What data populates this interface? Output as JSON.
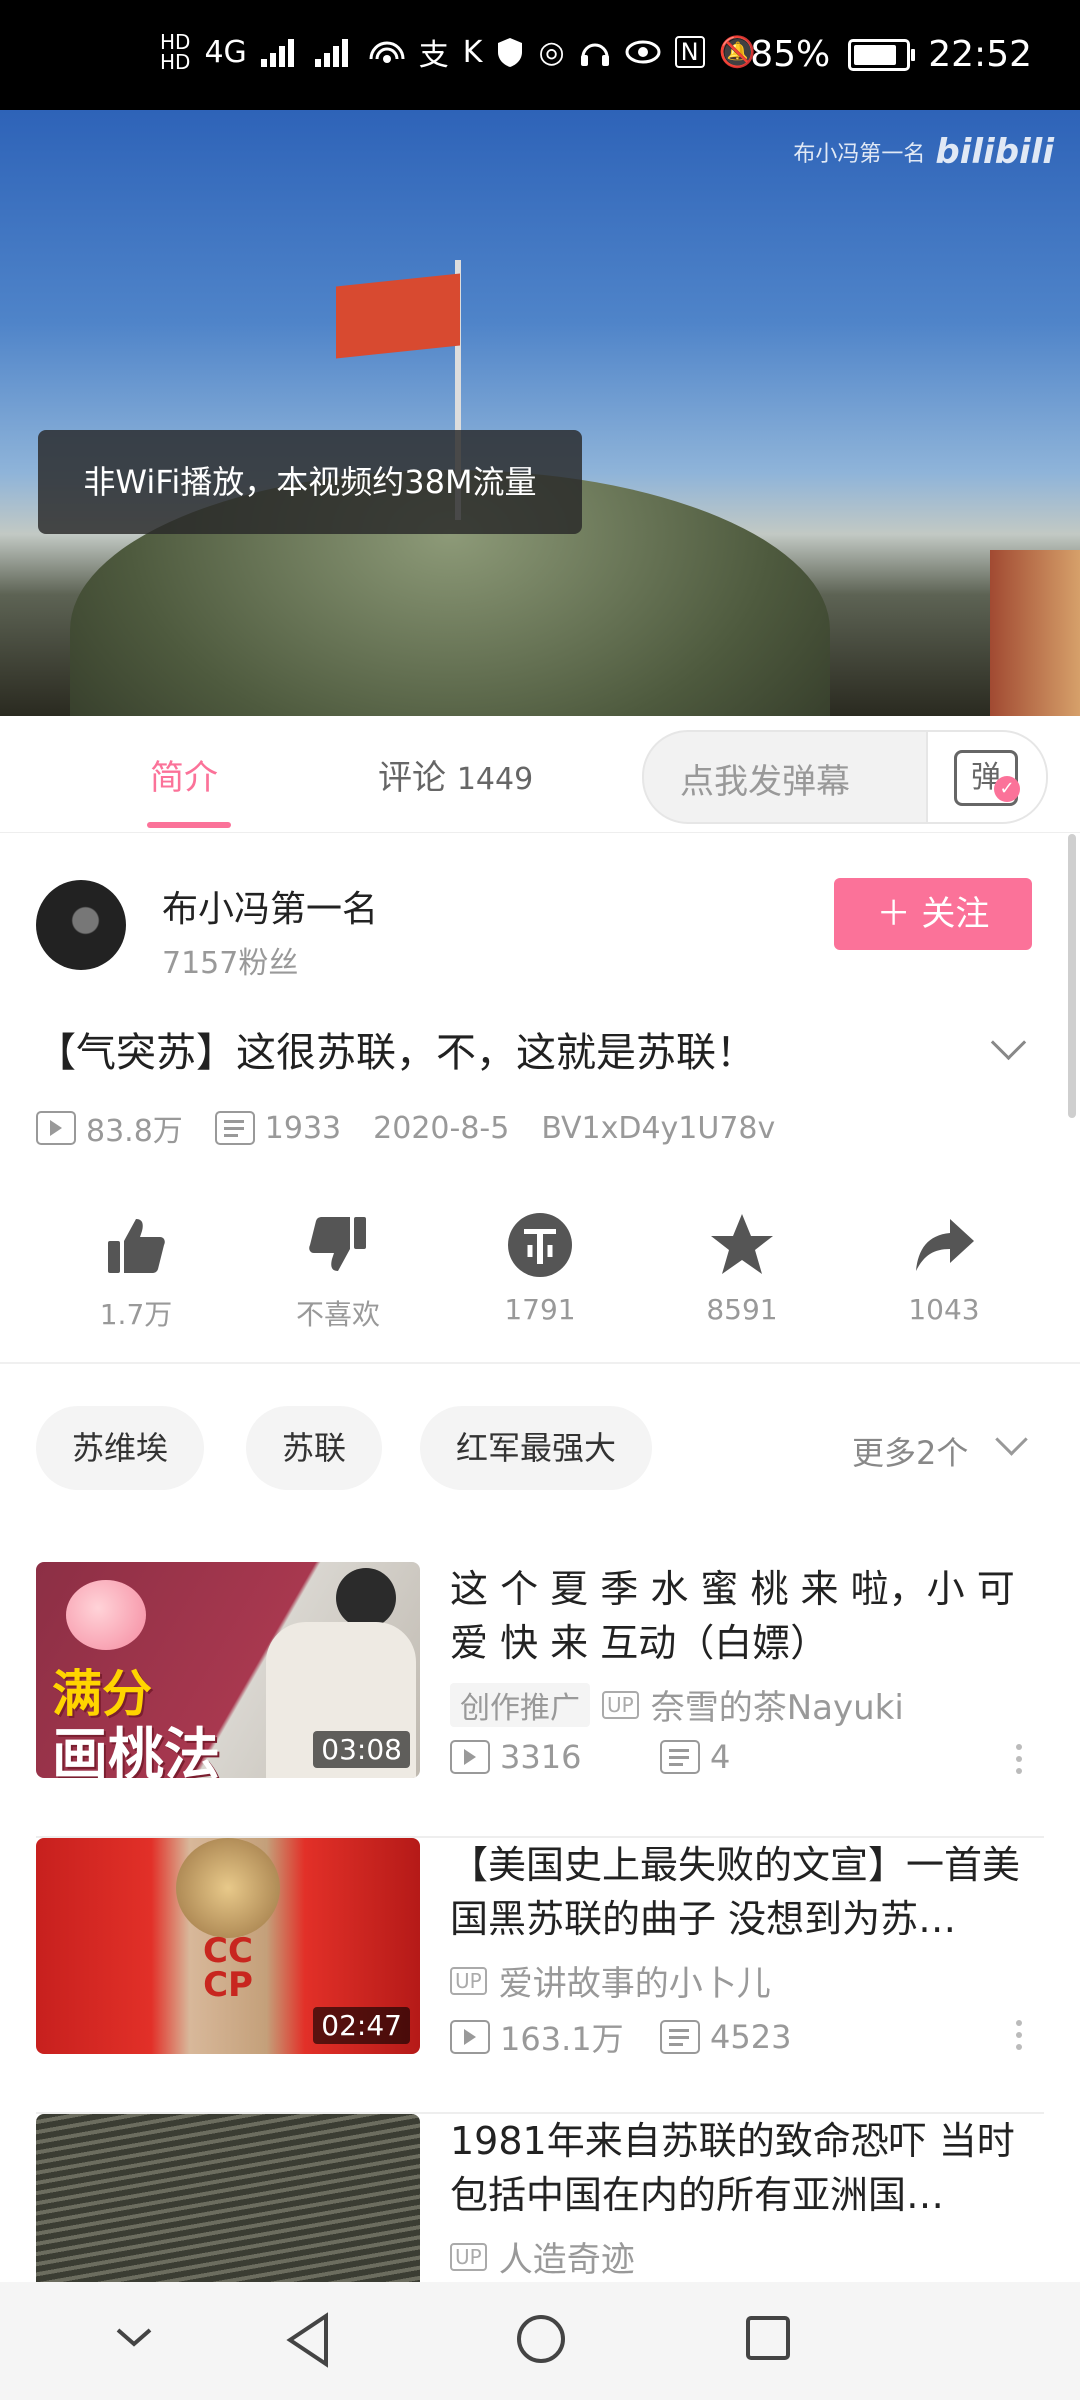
{
  "status_bar": {
    "battery": "85%",
    "time": "22:52",
    "network": "4G",
    "icons": [
      "hd-icon",
      "signal-icon",
      "wifi-icon",
      "alipay-icon",
      "app-icon",
      "shield-icon",
      "hotspot-icon",
      "headphones-icon",
      "eye-icon",
      "nfc-icon",
      "mute-icon",
      "battery-icon"
    ]
  },
  "player": {
    "watermark_text": "布小冯第一名",
    "watermark_logo": "bilibili",
    "toast": "非WiFi播放，本视频约38M流量"
  },
  "tabs": {
    "intro": "简介",
    "comments": "评论",
    "comments_count": "1449",
    "danmaku_placeholder": "点我发弹幕",
    "danmaku_button": "弹"
  },
  "uploader": {
    "name": "布小冯第一名",
    "fans": "7157粉丝",
    "follow_label": "＋ 关注"
  },
  "video": {
    "title": "【气突苏】这很苏联，不，这就是苏联！",
    "views": "83.8万",
    "danmaku_count": "1933",
    "date": "2020-8-5",
    "bvid": "BV1xD4y1U78v"
  },
  "actions": {
    "like": "1.7万",
    "dislike": "不喜欢",
    "coin": "1791",
    "favorite": "8591",
    "share": "1043"
  },
  "tags": {
    "items": [
      "苏维埃",
      "苏联",
      "红军最强大"
    ],
    "more": "更多2个"
  },
  "recommended": [
    {
      "title": "这 个 夏 季 水 蜜 桃 来 啦，小 可 爱 快 来 互动（白嫖）",
      "badge": "创作推广",
      "up_tag": "UP",
      "uploader": "奈雪的茶Nayuki",
      "views": "3316",
      "danmaku": "4",
      "duration": "03:08",
      "thumb_text_1": "满分",
      "thumb_text_2": "画桃法"
    },
    {
      "title": "【美国史上最失败的文宣】一首美国黑苏联的曲子 没想到为苏…",
      "up_tag": "UP",
      "uploader": "爱讲故事的小卜儿",
      "views": "163.1万",
      "danmaku": "4523",
      "duration": "02:47",
      "thumb_text": "СССР"
    },
    {
      "title": "1981年来自苏联的致命恐吓 当时包括中国在内的所有亚洲国…",
      "up_tag": "UP",
      "uploader": "人造奇迹"
    }
  ]
}
